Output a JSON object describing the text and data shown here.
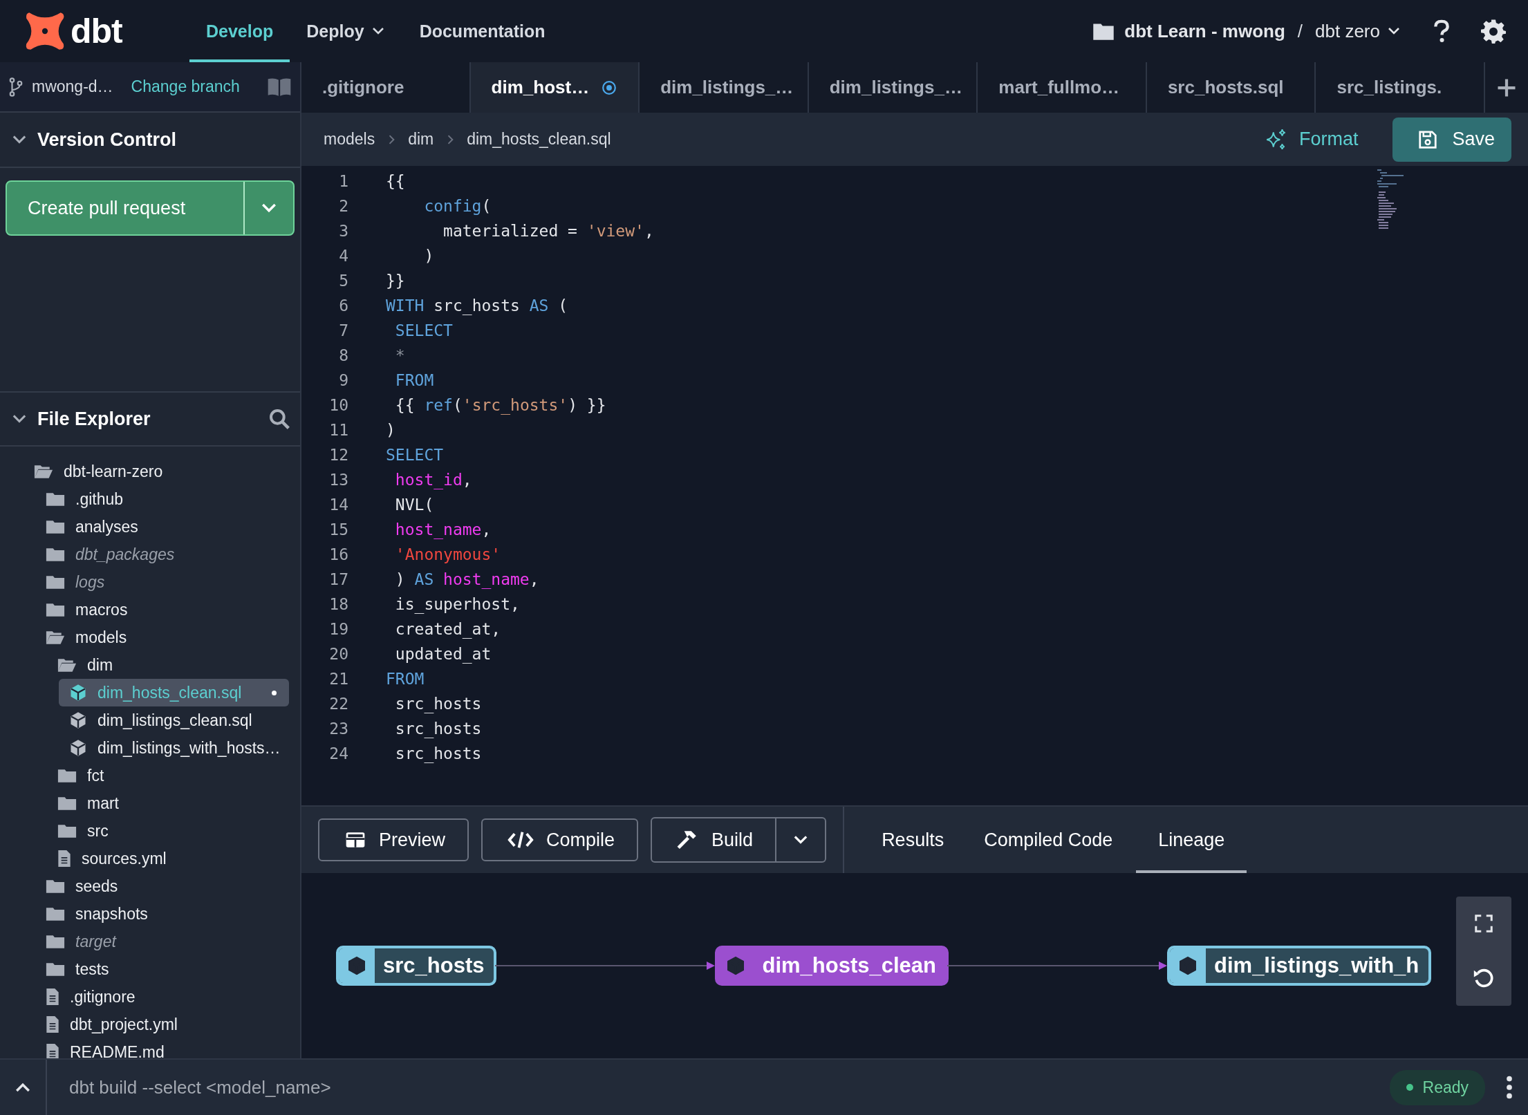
{
  "nav": {
    "logo_text": "dbt",
    "items": [
      {
        "label": "Develop",
        "selected": true,
        "menu": false
      },
      {
        "label": "Deploy",
        "selected": false,
        "menu": true
      },
      {
        "label": "Documentation",
        "selected": false,
        "menu": false
      }
    ]
  },
  "project": {
    "account": "dbt Learn - mwong",
    "separator": "/",
    "name": "dbt zero"
  },
  "branch": {
    "name": "mwong-d…",
    "action": "Change branch"
  },
  "version_control": {
    "title": "Version Control",
    "expanded": true,
    "button": "Create pull request"
  },
  "file_explorer": {
    "title": "File Explorer",
    "expanded": true,
    "tree": [
      {
        "name": "dbt-learn-zero",
        "kind": "folder",
        "expanded": true,
        "ignored": false,
        "selected": false,
        "modified": false,
        "children": [
          {
            "name": ".github",
            "kind": "folder",
            "expanded": false,
            "ignored": false,
            "selected": false,
            "modified": false
          },
          {
            "name": "analyses",
            "kind": "folder",
            "expanded": false,
            "ignored": false,
            "selected": false,
            "modified": false
          },
          {
            "name": "dbt_packages",
            "kind": "folder",
            "expanded": false,
            "ignored": true,
            "selected": false,
            "modified": false
          },
          {
            "name": "logs",
            "kind": "folder",
            "expanded": false,
            "ignored": true,
            "selected": false,
            "modified": false
          },
          {
            "name": "macros",
            "kind": "folder",
            "expanded": false,
            "ignored": false,
            "selected": false,
            "modified": false
          },
          {
            "name": "models",
            "kind": "folder",
            "expanded": true,
            "ignored": false,
            "selected": false,
            "modified": false,
            "children": [
              {
                "name": "dim",
                "kind": "folder",
                "expanded": true,
                "ignored": false,
                "selected": false,
                "modified": false,
                "children": [
                  {
                    "name": "dim_hosts_clean.sql",
                    "kind": "model",
                    "ignored": false,
                    "selected": true,
                    "modified": true
                  },
                  {
                    "name": "dim_listings_clean.sql",
                    "kind": "model",
                    "ignored": false,
                    "selected": false,
                    "modified": false
                  },
                  {
                    "name": "dim_listings_with_hosts…",
                    "kind": "model",
                    "ignored": false,
                    "selected": false,
                    "modified": false
                  }
                ]
              },
              {
                "name": "fct",
                "kind": "folder",
                "expanded": false,
                "ignored": false,
                "selected": false,
                "modified": false
              },
              {
                "name": "mart",
                "kind": "folder",
                "expanded": false,
                "ignored": false,
                "selected": false,
                "modified": false
              },
              {
                "name": "src",
                "kind": "folder",
                "expanded": false,
                "ignored": false,
                "selected": false,
                "modified": false
              },
              {
                "name": "sources.yml",
                "kind": "file",
                "ignored": false,
                "selected": false,
                "modified": false
              }
            ]
          },
          {
            "name": "seeds",
            "kind": "folder",
            "expanded": false,
            "ignored": false,
            "selected": false,
            "modified": false
          },
          {
            "name": "snapshots",
            "kind": "folder",
            "expanded": false,
            "ignored": false,
            "selected": false,
            "modified": false
          },
          {
            "name": "target",
            "kind": "folder",
            "expanded": false,
            "ignored": true,
            "selected": false,
            "modified": false
          },
          {
            "name": "tests",
            "kind": "folder",
            "expanded": false,
            "ignored": false,
            "selected": false,
            "modified": false
          },
          {
            "name": ".gitignore",
            "kind": "file",
            "ignored": false,
            "selected": false,
            "modified": false
          },
          {
            "name": "dbt_project.yml",
            "kind": "file",
            "ignored": false,
            "selected": false,
            "modified": false
          },
          {
            "name": "README.md",
            "kind": "file",
            "ignored": false,
            "selected": false,
            "modified": false
          }
        ]
      }
    ]
  },
  "tabs": [
    {
      "label": ".gitignore",
      "selected": false,
      "modified": false
    },
    {
      "label": "dim_host…",
      "selected": true,
      "modified": true
    },
    {
      "label": "dim_listings_…",
      "selected": false,
      "modified": false
    },
    {
      "label": "dim_listings_…",
      "selected": false,
      "modified": false
    },
    {
      "label": "mart_fullmo…",
      "selected": false,
      "modified": false
    },
    {
      "label": "src_hosts.sql",
      "selected": false,
      "modified": false
    },
    {
      "label": "src_listings.",
      "selected": false,
      "modified": false
    }
  ],
  "breadcrumb": [
    "models",
    "dim",
    "dim_hosts_clean.sql"
  ],
  "editor_actions": {
    "format": "Format",
    "save": "Save"
  },
  "code": [
    {
      "number": "1",
      "tokens": [
        {
          "text": "{{",
          "kind": "plain"
        }
      ]
    },
    {
      "number": "2",
      "tokens": [
        {
          "text": "    config",
          "kind": "keyword"
        },
        {
          "text": "(",
          "kind": "plain"
        }
      ]
    },
    {
      "number": "3",
      "tokens": [
        {
          "text": "      materialized = ",
          "kind": "plain"
        },
        {
          "text": "'view'",
          "kind": "string"
        },
        {
          "text": ",",
          "kind": "plain"
        }
      ]
    },
    {
      "number": "4",
      "tokens": [
        {
          "text": "    )",
          "kind": "plain"
        }
      ]
    },
    {
      "number": "5",
      "tokens": [
        {
          "text": "}}",
          "kind": "plain"
        }
      ]
    },
    {
      "number": "6",
      "tokens": [
        {
          "text": "WITH",
          "kind": "keyword"
        },
        {
          "text": " src_hosts ",
          "kind": "plain"
        },
        {
          "text": "AS",
          "kind": "keyword"
        },
        {
          "text": " (",
          "kind": "plain"
        }
      ]
    },
    {
      "number": "7",
      "tokens": [
        {
          "text": " SELECT",
          "kind": "keyword"
        }
      ]
    },
    {
      "number": "8",
      "tokens": [
        {
          "text": " *",
          "kind": "operator"
        }
      ]
    },
    {
      "number": "9",
      "tokens": [
        {
          "text": " FROM",
          "kind": "keyword"
        }
      ]
    },
    {
      "number": "10",
      "tokens": [
        {
          "text": " {{ ",
          "kind": "plain"
        },
        {
          "text": "ref",
          "kind": "keyword"
        },
        {
          "text": "(",
          "kind": "plain"
        },
        {
          "text": "'src_hosts'",
          "kind": "string"
        },
        {
          "text": ") }}",
          "kind": "plain"
        }
      ]
    },
    {
      "number": "11",
      "tokens": [
        {
          "text": ")",
          "kind": "plain"
        }
      ]
    },
    {
      "number": "12",
      "tokens": [
        {
          "text": "SELECT",
          "kind": "keyword"
        }
      ]
    },
    {
      "number": "13",
      "tokens": [
        {
          "text": " host_id",
          "kind": "field"
        },
        {
          "text": ",",
          "kind": "plain"
        }
      ]
    },
    {
      "number": "14",
      "tokens": [
        {
          "text": " NVL(",
          "kind": "plain"
        }
      ]
    },
    {
      "number": "15",
      "tokens": [
        {
          "text": " host_name",
          "kind": "field"
        },
        {
          "text": ",",
          "kind": "plain"
        }
      ]
    },
    {
      "number": "16",
      "tokens": [
        {
          "text": " 'Anonymous'",
          "kind": "literal"
        }
      ]
    },
    {
      "number": "17",
      "tokens": [
        {
          "text": " ) ",
          "kind": "plain"
        },
        {
          "text": "AS ",
          "kind": "keyword"
        },
        {
          "text": "host_name",
          "kind": "field"
        },
        {
          "text": ",",
          "kind": "plain"
        }
      ]
    },
    {
      "number": "18",
      "tokens": [
        {
          "text": " is_superhost,",
          "kind": "plain"
        }
      ]
    },
    {
      "number": "19",
      "tokens": [
        {
          "text": " created_at,",
          "kind": "plain"
        }
      ]
    },
    {
      "number": "20",
      "tokens": [
        {
          "text": " updated_at",
          "kind": "plain"
        }
      ]
    },
    {
      "number": "21",
      "tokens": [
        {
          "text": "FROM",
          "kind": "keyword"
        }
      ]
    },
    {
      "number": "22",
      "tokens": [
        {
          "text": " src_hosts",
          "kind": "plain"
        }
      ]
    },
    {
      "number": "23",
      "tokens": [
        {
          "text": " src_hosts",
          "kind": "plain"
        }
      ]
    },
    {
      "number": "24",
      "tokens": [
        {
          "text": " src_hosts",
          "kind": "plain"
        }
      ]
    }
  ],
  "run_buttons": [
    {
      "label": "Preview",
      "kind": "table",
      "menu": false
    },
    {
      "label": "Compile",
      "kind": "code",
      "menu": false
    },
    {
      "label": "Build",
      "kind": "hammer",
      "menu": true
    }
  ],
  "output_tabs": [
    {
      "label": "Results",
      "selected": false
    },
    {
      "label": "Compiled Code",
      "selected": false
    },
    {
      "label": "Lineage",
      "selected": true
    }
  ],
  "lineage": {
    "nodes": [
      {
        "label": "src_hosts",
        "color": "#7ec8e3",
        "selected": false
      },
      {
        "label": "dim_hosts_clean",
        "color": "#9b4fcf",
        "selected": true
      },
      {
        "label": "dim_listings_with_h",
        "color": "#7ec8e3",
        "selected": false
      }
    ]
  },
  "command": {
    "placeholder": "dbt build --select <model_name>"
  },
  "status": {
    "label": "Ready"
  }
}
